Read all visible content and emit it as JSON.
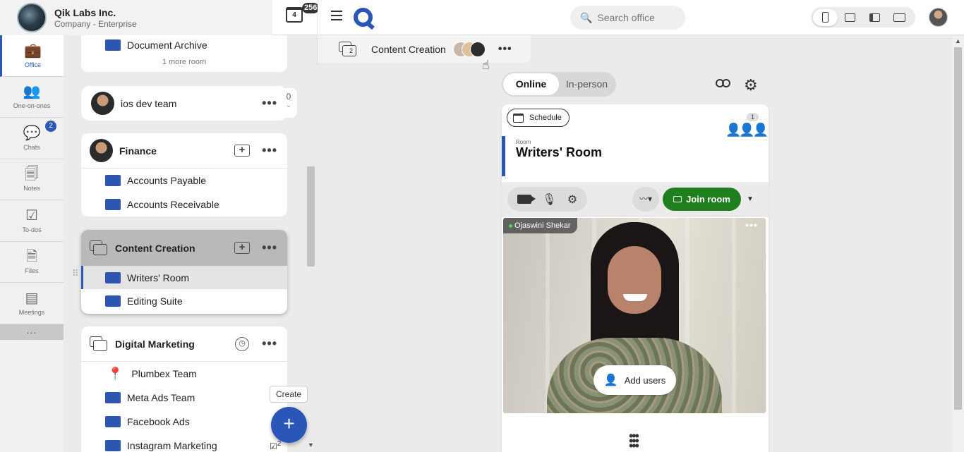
{
  "org": {
    "name": "Qik Labs Inc.",
    "plan": "Company - Enterprise"
  },
  "calendar": {
    "day": "4",
    "badge": "256"
  },
  "nav": {
    "items": [
      {
        "label": "Office",
        "icon": "briefcase-icon",
        "active": true
      },
      {
        "label": "One-on-ones",
        "icon": "people-icon"
      },
      {
        "label": "Chats",
        "icon": "chat-icon",
        "badge": "2"
      },
      {
        "label": "Notes",
        "icon": "notes-icon"
      },
      {
        "label": "To-dos",
        "icon": "checkbox-icon"
      },
      {
        "label": "Files",
        "icon": "files-icon"
      },
      {
        "label": "Meetings",
        "icon": "meetings-icon"
      }
    ],
    "more": "..."
  },
  "list": {
    "top_card": {
      "room": "Document Archive",
      "more": "1 more room"
    },
    "ios": {
      "name": "ios dev team",
      "count": "0"
    },
    "finance": {
      "name": "Finance",
      "rooms": [
        "Accounts Payable",
        "Accounts Receivable"
      ]
    },
    "content": {
      "name": "Content Creation",
      "rooms": [
        "Writers' Room",
        "Editing Suite"
      ]
    },
    "marketing": {
      "name": "Digital Marketing",
      "rooms": [
        "Plumbex Team",
        "Meta Ads Team",
        "Facebook Ads",
        "Instagram Marketing"
      ]
    },
    "create_tooltip": "Create",
    "fab_label": "+",
    "todo_badge": "2"
  },
  "search": {
    "placeholder": "Search office"
  },
  "breadcrumb": {
    "title": "Content Creation",
    "count": "2"
  },
  "mode": {
    "online": "Online",
    "inperson": "In-person"
  },
  "room": {
    "schedule": "Schedule",
    "kicker": "Room",
    "title": "Writers' Room",
    "participants": "1",
    "join": "Join room",
    "participant_name": "Ojaswini Shekar",
    "add_users": "Add users"
  },
  "colors": {
    "accent": "#2a56b8",
    "join": "#1f7f1f"
  }
}
